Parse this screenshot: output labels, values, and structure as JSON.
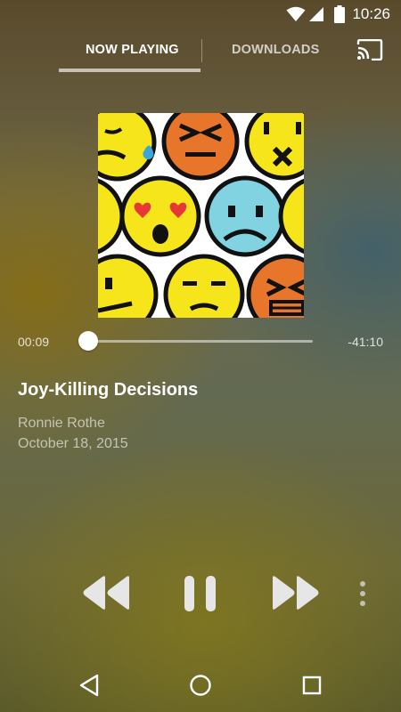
{
  "status_bar": {
    "time": "10:26",
    "icons": [
      "wifi-icon",
      "signal-icon",
      "battery-icon"
    ]
  },
  "tabs": [
    {
      "label": "NOW PLAYING",
      "selected": true
    },
    {
      "label": "DOWNLOADS",
      "selected": false
    }
  ],
  "cast_icon": "cast-icon",
  "album_art": {
    "description_icons": [
      "emoji-grid"
    ]
  },
  "player": {
    "elapsed": "00:09",
    "remaining": "-41:10",
    "progress_fraction": 0.004
  },
  "track": {
    "title": "Joy-Killing Decisions",
    "artist": "Ronnie Rothe",
    "date": "October 18, 2015"
  },
  "controls": [
    "rewind-icon",
    "pause-icon",
    "fast-forward-icon",
    "more-vert-icon"
  ],
  "navigation": [
    "back-icon",
    "home-icon",
    "recents-icon"
  ],
  "colors": {
    "emoji_yellow": "#f5e51a",
    "emoji_orange": "#e8762a",
    "emoji_blue": "#82d3e2",
    "heart_red": "#e53935"
  }
}
